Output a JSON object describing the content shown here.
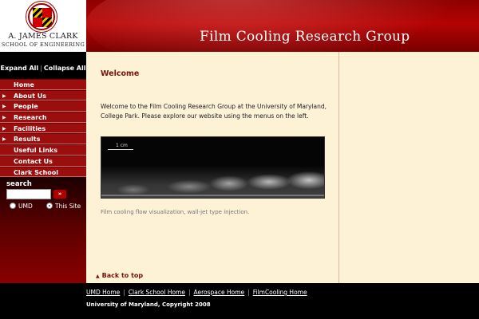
{
  "header": {
    "school_name": "A. JAMES CLARK",
    "school_sub": "SCHOOL OF ENGINEERING",
    "site_title": "Film Cooling Research Group",
    "seal_text": "UNIVERSITY OF MARYLAND"
  },
  "sidebar": {
    "expand_all": "Expand All",
    "collapse_all": "Collapse All",
    "items": [
      {
        "label": "Home",
        "has_arrow": false
      },
      {
        "label": "About Us",
        "has_arrow": true
      },
      {
        "label": "People",
        "has_arrow": true
      },
      {
        "label": "Research",
        "has_arrow": true
      },
      {
        "label": "Facilities",
        "has_arrow": true
      },
      {
        "label": "Results",
        "has_arrow": true
      },
      {
        "label": "Useful Links",
        "has_arrow": false
      },
      {
        "label": "Contact Us",
        "has_arrow": false
      },
      {
        "label": "Clark School",
        "has_arrow": false
      }
    ],
    "search": {
      "title": "search",
      "placeholder": "",
      "go_label": "»",
      "options": [
        {
          "label": "UMD",
          "selected": false
        },
        {
          "label": "This Site",
          "selected": true
        }
      ]
    }
  },
  "main": {
    "heading": "Welcome",
    "intro": "Welcome to the Film Cooling Research Group at the University of Maryland, College Park. Please explore our website using the menus on the left.",
    "image_scale_label": "1 cm",
    "caption": "Film cooling flow visualization, wall-jet type injection.",
    "back_to_top": "Back to top"
  },
  "footer": {
    "links": [
      "UMD Home",
      "Clark School Home",
      "Aerospace Home",
      "FilmCooling Home"
    ],
    "copyright": "University of Maryland, Copyright 2008"
  },
  "colors": {
    "brand_red": "#9a0e0e",
    "content_bg": "#fdf1d6",
    "heading": "#7a1010"
  }
}
